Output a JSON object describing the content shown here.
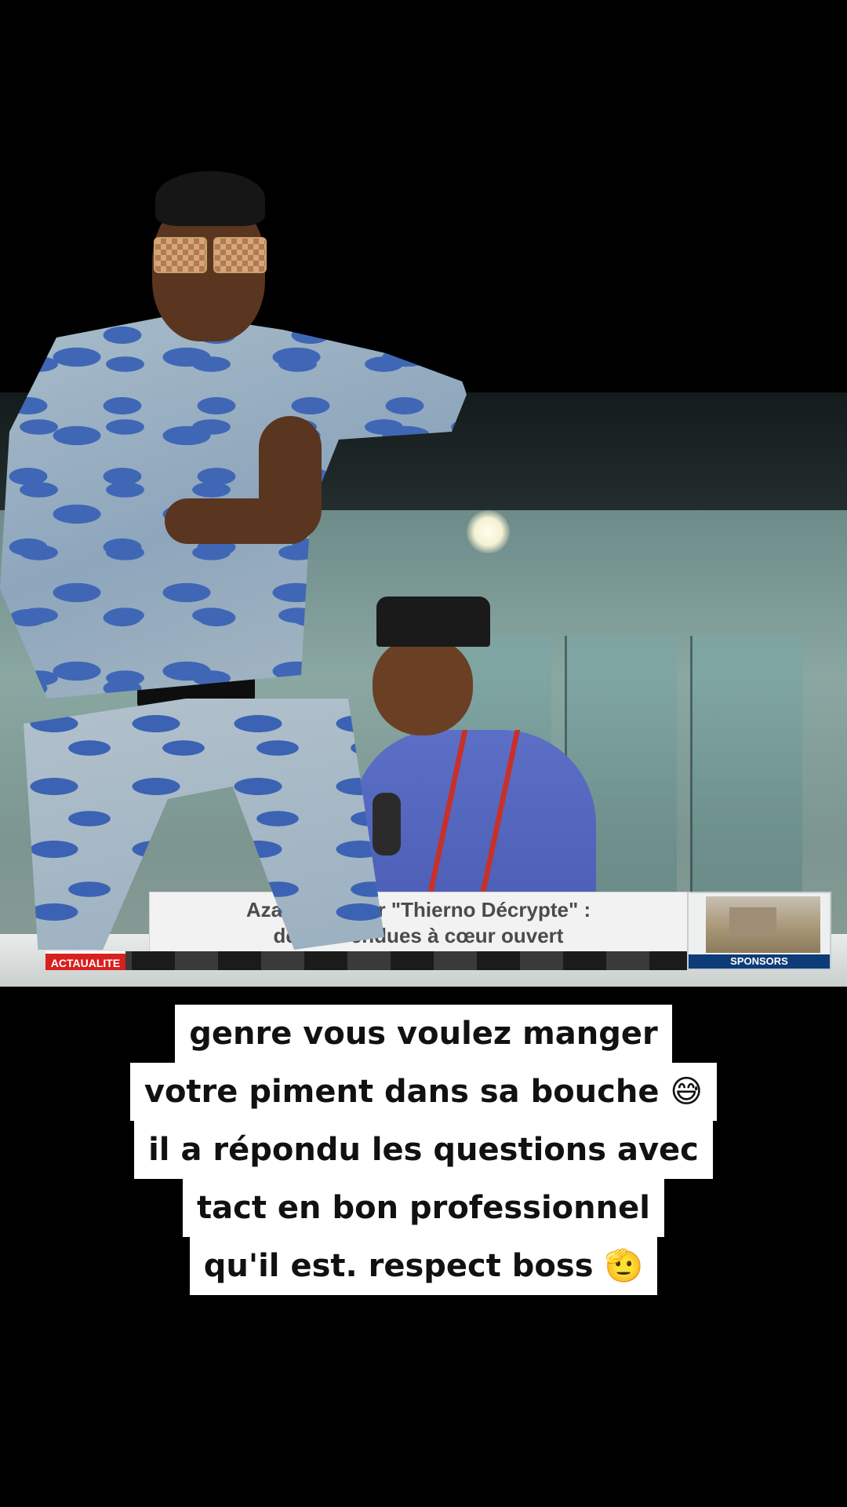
{
  "broadcast": {
    "lower_third": {
      "line1": "Azaya br          e sur \"Thierno Décrypte\" :",
      "line2": "des rév             endues à cœur ouvert"
    },
    "section_tag": "ACTAUALITE",
    "sponsor_label": "SPONSORS"
  },
  "caption": {
    "lines": [
      "genre vous voulez manger",
      "votre piment dans sa bouche 😅",
      "il a répondu les questions avec",
      "tact en bon professionnel",
      "qu'il est. respect boss 🫡"
    ]
  },
  "colors": {
    "background": "#000000",
    "caption_bg": "#ffffff",
    "tag_red": "#d7201f",
    "sponsor_blue": "#0d3c78"
  }
}
